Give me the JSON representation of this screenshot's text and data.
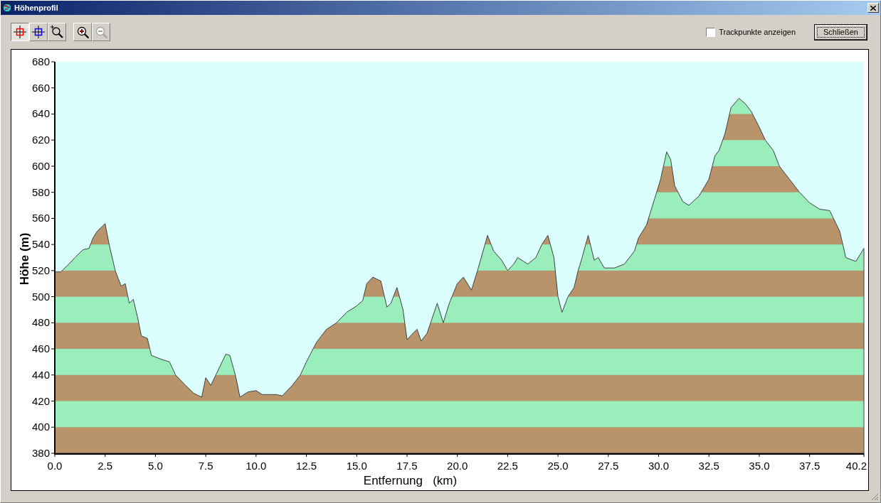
{
  "window": {
    "title": "Höhenprofil"
  },
  "toolbar": [
    {
      "kind": "red-crosshair",
      "selected": true,
      "disabled": false
    },
    {
      "kind": "blue-crosshair",
      "selected": false,
      "disabled": false
    },
    {
      "kind": "zoom-box",
      "selected": false,
      "disabled": false
    },
    {
      "kind": "zoom-in",
      "selected": false,
      "disabled": false
    },
    {
      "kind": "zoom-out",
      "selected": false,
      "disabled": true
    }
  ],
  "trackpoints": {
    "label": "Trackpunkte anzeigen",
    "checked": false
  },
  "close_button": "Schließen",
  "chart_data": {
    "type": "area",
    "xlabel": "Entfernung   (km)",
    "ylabel": "Höhe (m)",
    "x": [
      0,
      0.3,
      0.7,
      1.0,
      1.4,
      1.7,
      1.9,
      2.1,
      2.3,
      2.5,
      2.7,
      3.0,
      3.3,
      3.5,
      3.7,
      3.9,
      4.1,
      4.3,
      4.6,
      4.8,
      5.3,
      5.7,
      6.0,
      6.5,
      6.9,
      7.3,
      7.5,
      7.75,
      8.0,
      8.5,
      8.7,
      9.0,
      9.2,
      9.6,
      10.0,
      10.3,
      11.0,
      11.3,
      11.8,
      12.2,
      12.5,
      13.0,
      13.5,
      14.0,
      14.5,
      15.0,
      15.3,
      15.5,
      15.8,
      16.2,
      16.5,
      16.7,
      17.0,
      17.3,
      17.5,
      17.8,
      18.0,
      18.2,
      18.5,
      19.0,
      19.3,
      19.6,
      20.0,
      20.3,
      20.7,
      21.0,
      21.5,
      21.8,
      22.2,
      22.5,
      22.8,
      23.0,
      23.5,
      23.9,
      24.2,
      24.5,
      24.8,
      25.0,
      25.2,
      25.5,
      25.8,
      26.0,
      26.2,
      26.5,
      26.8,
      27.0,
      27.3,
      27.8,
      28.3,
      28.8,
      29.0,
      29.4,
      29.8,
      30.1,
      30.4,
      30.6,
      30.8,
      31.2,
      31.5,
      32.0,
      32.5,
      32.8,
      33.0,
      33.3,
      33.6,
      34.0,
      34.3,
      34.6,
      35.0,
      35.3,
      35.7,
      36.0,
      36.5,
      37.0,
      37.5,
      38.0,
      38.5,
      39.0,
      39.3,
      39.8,
      40.0,
      40.2
    ],
    "values": [
      519,
      519,
      525,
      530,
      536,
      537,
      545,
      550,
      553,
      556,
      540,
      520,
      508,
      510,
      495,
      498,
      485,
      470,
      468,
      455,
      452,
      450,
      440,
      432,
      426,
      423,
      438,
      432,
      440,
      456,
      455,
      438,
      423,
      427,
      428,
      425,
      425,
      424,
      432,
      440,
      450,
      465,
      475,
      480,
      488,
      493,
      497,
      510,
      515,
      512,
      492,
      495,
      507,
      490,
      467,
      472,
      475,
      466,
      472,
      495,
      480,
      495,
      510,
      515,
      505,
      520,
      547,
      535,
      528,
      520,
      525,
      530,
      525,
      530,
      540,
      547,
      530,
      500,
      488,
      500,
      507,
      520,
      530,
      547,
      528,
      530,
      522,
      522,
      525,
      535,
      545,
      555,
      575,
      590,
      611,
      605,
      585,
      573,
      570,
      577,
      590,
      608,
      612,
      625,
      645,
      652,
      648,
      642,
      630,
      620,
      612,
      600,
      590,
      580,
      572,
      567,
      566,
      550,
      530,
      527,
      532,
      537
    ],
    "xlim": [
      0,
      40.2
    ],
    "ylim": [
      380,
      680
    ],
    "xticks": [
      {
        "value": 0,
        "label": "0.0"
      },
      2.5,
      {
        "value": 5,
        "label": "5.0"
      },
      7.5,
      {
        "value": 10,
        "label": "10.0"
      },
      12.5,
      {
        "value": 15,
        "label": "15.0"
      },
      17.5,
      {
        "value": 20,
        "label": "20.0"
      },
      22.5,
      {
        "value": 25,
        "label": "25.0"
      },
      27.5,
      {
        "value": 30,
        "label": "30.0"
      },
      32.5,
      {
        "value": 35,
        "label": "35.0"
      },
      37.5,
      {
        "value": 40.2,
        "label": "40.2"
      }
    ],
    "yticks": [
      380,
      400,
      420,
      440,
      460,
      480,
      500,
      520,
      540,
      560,
      580,
      600,
      620,
      640,
      660,
      680
    ]
  }
}
